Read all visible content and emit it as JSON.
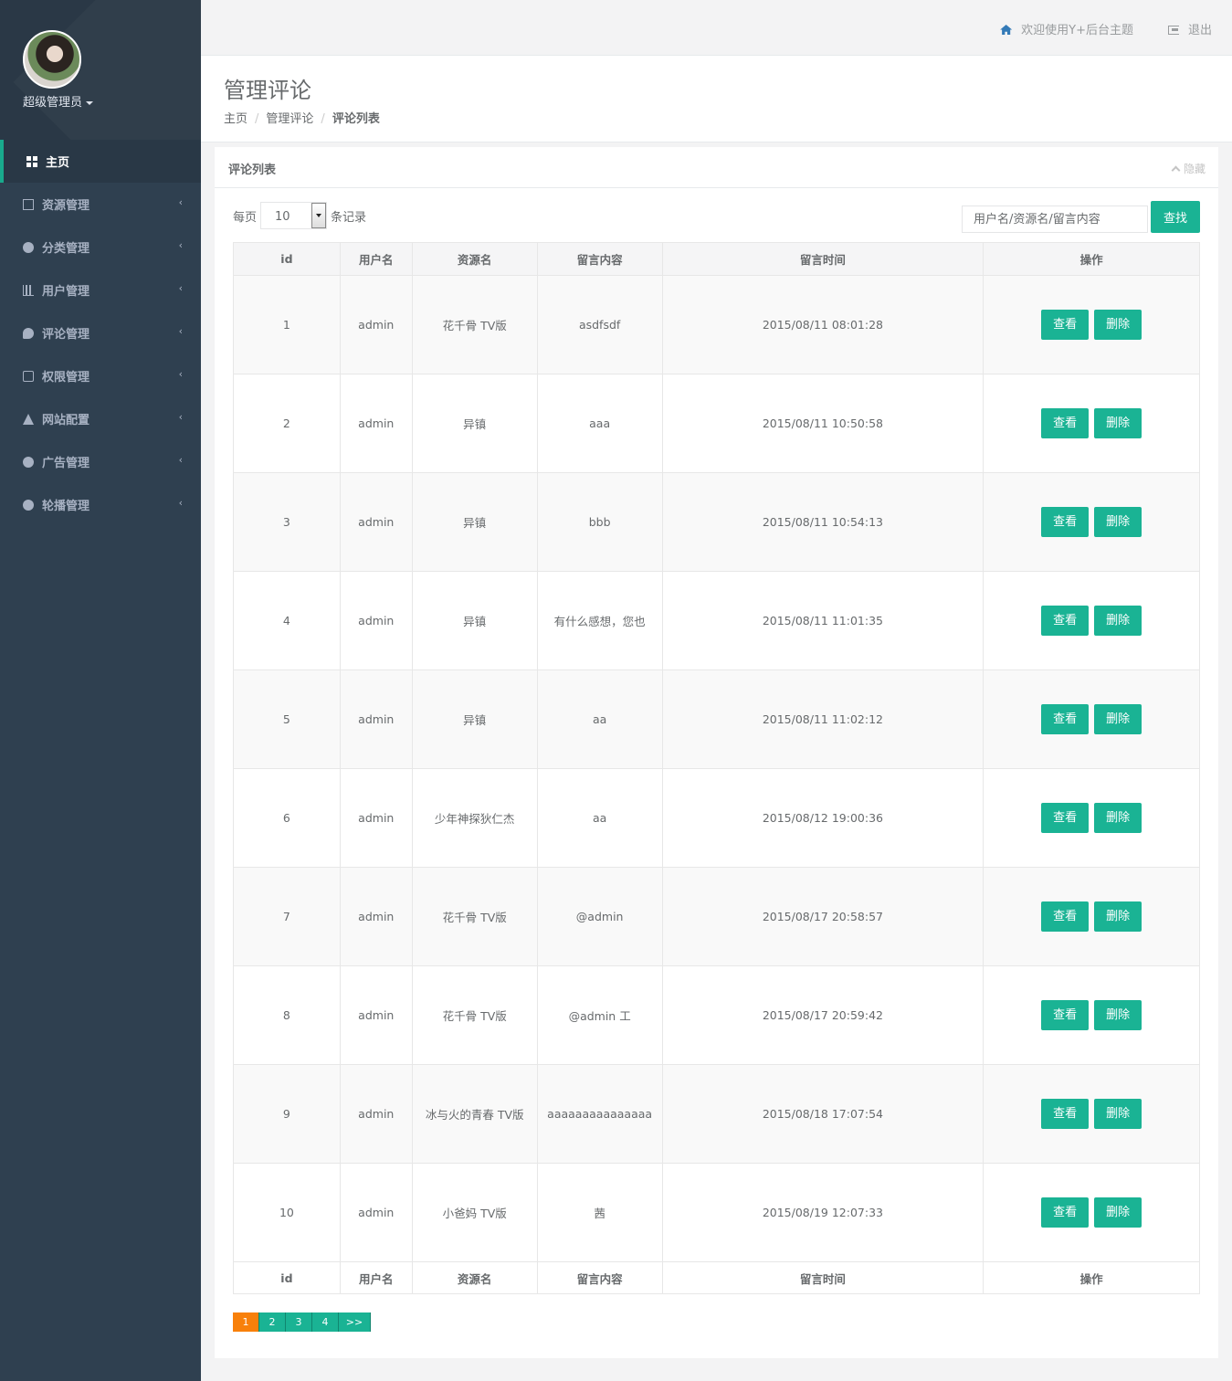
{
  "sidebar": {
    "role": "超级管理员",
    "items": [
      {
        "label": "主页"
      },
      {
        "label": "资源管理"
      },
      {
        "label": "分类管理"
      },
      {
        "label": "用户管理"
      },
      {
        "label": "评论管理"
      },
      {
        "label": "权限管理"
      },
      {
        "label": "网站配置"
      },
      {
        "label": "广告管理"
      },
      {
        "label": "轮播管理"
      }
    ],
    "chevron": "‹"
  },
  "topbar": {
    "welcome": "欢迎使用Y+后台主题",
    "logout": "退出"
  },
  "heading": {
    "title": "管理评论",
    "breadcrumb": [
      "主页",
      "管理评论",
      "评论列表"
    ],
    "separator": "/"
  },
  "panel": {
    "title": "评论列表",
    "hide": "隐藏",
    "per_page_label": "每页",
    "per_page_value": "10",
    "records_label": "条记录",
    "search_placeholder": "用户名/资源名/留言内容",
    "search_button": "查找"
  },
  "table": {
    "columns": [
      "id",
      "用户名",
      "资源名",
      "留言内容",
      "留言时间",
      "操作"
    ],
    "view_label": "查看",
    "delete_label": "删除",
    "rows": [
      {
        "id": "1",
        "user": "admin",
        "resource": "花千骨 TV版",
        "content": "asdfsdf",
        "time": "2015/08/11 08:01:28"
      },
      {
        "id": "2",
        "user": "admin",
        "resource": "异镇",
        "content": "aaa",
        "time": "2015/08/11 10:50:58"
      },
      {
        "id": "3",
        "user": "admin",
        "resource": "异镇",
        "content": "bbb",
        "time": "2015/08/11 10:54:13"
      },
      {
        "id": "4",
        "user": "admin",
        "resource": "异镇",
        "content": "有什么感想，您也",
        "time": "2015/08/11 11:01:35"
      },
      {
        "id": "5",
        "user": "admin",
        "resource": "异镇",
        "content": "aa",
        "time": "2015/08/11 11:02:12"
      },
      {
        "id": "6",
        "user": "admin",
        "resource": "少年神探狄仁杰",
        "content": "aa",
        "time": "2015/08/12 19:00:36"
      },
      {
        "id": "7",
        "user": "admin",
        "resource": "花千骨 TV版",
        "content": "@admin",
        "time": "2015/08/17 20:58:57"
      },
      {
        "id": "8",
        "user": "admin",
        "resource": "花千骨 TV版",
        "content": "@admin 工",
        "time": "2015/08/17 20:59:42"
      },
      {
        "id": "9",
        "user": "admin",
        "resource": "冰与火的青春 TV版",
        "content": "aaaaaaaaaaaaaaa",
        "time": "2015/08/18 17:07:54"
      },
      {
        "id": "10",
        "user": "admin",
        "resource": "小爸妈 TV版",
        "content": "茜",
        "time": "2015/08/19 12:07:33"
      }
    ]
  },
  "pagination": {
    "pages": [
      "1",
      "2",
      "3",
      "4"
    ],
    "current": "1",
    "next": ">>"
  }
}
